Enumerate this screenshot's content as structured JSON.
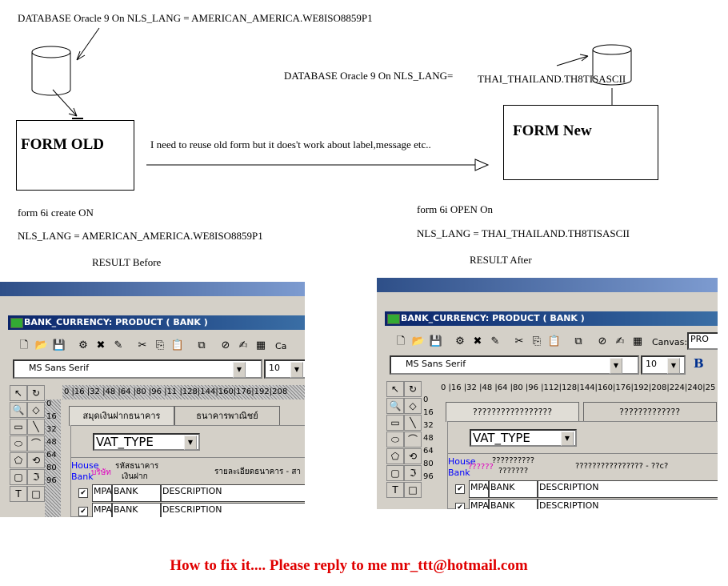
{
  "diagram": {
    "db_old_label": "DATABASE Oracle 9 On NLS_LANG = AMERICAN_AMERICA.WE8ISO8859P1",
    "db_new_label": "DATABASE  Oracle 9 On NLS_LANG=",
    "db_new_charset": "THAI_THAILAND.TH8TISASCII",
    "form_old": "FORM OLD",
    "form_new": "FORM New",
    "arrow_note": "I need to reuse old form but it does't work about label,message etc..",
    "old_create": "form 6i create ON",
    "old_nls": "NLS_LANG = AMERICAN_AMERICA.WE8ISO8859P1",
    "new_open": "form 6i OPEN On",
    "new_nls": "NLS_LANG = THAI_THAILAND.TH8TISASCII",
    "result_before": "RESULT    Before",
    "result_after": "RESULT    After",
    "footer": "How to fix it.... Please reply to me mr_ttt@hotmail.com",
    "footer_color": "#e00000"
  },
  "before": {
    "window_title": "BANK_CURRENCY: PRODUCT ( BANK )",
    "canvas_label": "Ca",
    "font": "MS Sans Serif",
    "size": "10",
    "ruler": "0  |16 |32 |48 |64 |80 |96 |11 |128|144|160|176|192|208",
    "vruler": [
      "0",
      "16",
      "32",
      "48",
      "64",
      "80",
      "96"
    ],
    "tabs": [
      "สมุดเงินฝากธนาคาร",
      "ธนาคารพาณิชย์"
    ],
    "vat": "VAT_TYPE",
    "hdr_house": "House",
    "hdr_bank": "Bank",
    "hdr_company": "บริษัท",
    "hdr_code1": "รหัสธนาคาร",
    "hdr_code2": "เงินฝาก",
    "hdr_desc": "รายละเอียดธนาคาร - สา",
    "rows": [
      [
        "MPA",
        "BANK",
        "DESCRIPTION"
      ],
      [
        "MPA",
        "BANK",
        "DESCRIPTION"
      ]
    ]
  },
  "after": {
    "window_title": "BANK_CURRENCY: PRODUCT ( BANK )",
    "canvas_label": "Canvas:",
    "canvas_value": "PRO",
    "font": "MS Sans Serif",
    "size": "10",
    "bold": "B",
    "ruler": "0  |16 |32 |48 |64 |80 |96 |112|128|144|160|176|192|208|224|240|25",
    "vruler": [
      "0",
      "16",
      "32",
      "48",
      "64",
      "80",
      "96"
    ],
    "tabs": [
      "?????????????????",
      "?????????????"
    ],
    "vat": "VAT_TYPE",
    "hdr_house": "House",
    "hdr_bank": "Bank",
    "hdr_company": "??????",
    "hdr_code1": "??????????",
    "hdr_code2": "???????",
    "hdr_desc": "???????????????? - ??c?",
    "rows": [
      [
        "MPA",
        "BANK",
        "DESCRIPTION"
      ],
      [
        "MPA",
        "BANK",
        "DESCRIPTION"
      ]
    ]
  }
}
